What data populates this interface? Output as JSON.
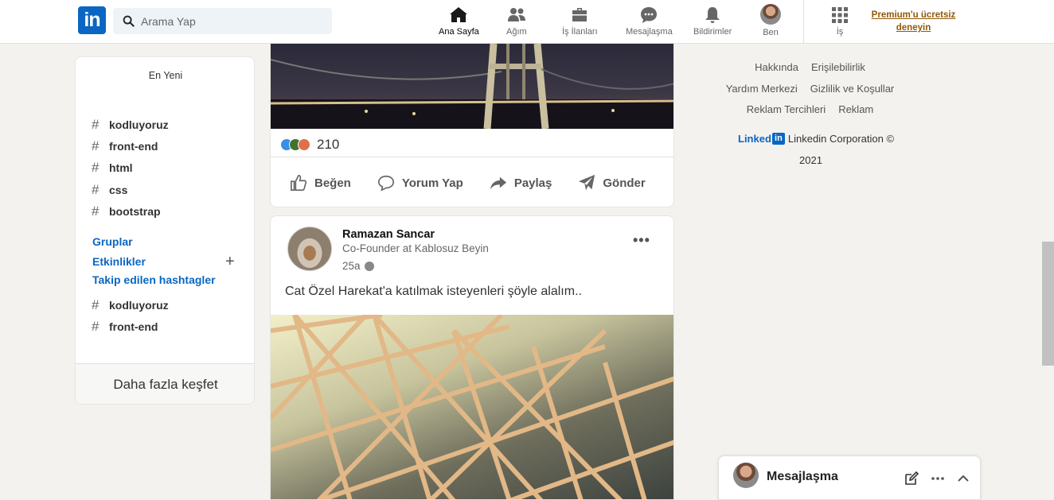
{
  "header": {
    "logo_text": "in",
    "search_placeholder": "Arama Yap",
    "nav": [
      {
        "label": "Ana Sayfa",
        "icon": "home-icon",
        "active": true
      },
      {
        "label": "Ağım",
        "icon": "network-icon"
      },
      {
        "label": "İş İlanları",
        "icon": "briefcase-icon"
      },
      {
        "label": "Mesajlaşma",
        "icon": "messaging-icon"
      },
      {
        "label": "Bildirimler",
        "icon": "bell-icon"
      },
      {
        "label": "Ben",
        "icon": "avatar"
      },
      {
        "label": "İş",
        "icon": "grid-icon"
      }
    ],
    "premium_text": "Premium'u ücretsiz deneyin"
  },
  "sidebar": {
    "recent_title": "En Yeni",
    "recent_tags": [
      "kodluyoruz",
      "front-end",
      "html",
      "css",
      "bootstrap"
    ],
    "groups_label": "Gruplar",
    "events_label": "Etkinlikler",
    "followed_label": "Takip edilen hashtagler",
    "followed_tags": [
      "kodluyoruz",
      "front-end"
    ],
    "discover_more": "Daha fazla keşfet"
  },
  "feed": {
    "post1": {
      "reaction_count": "210",
      "actions": [
        {
          "label": "Beğen",
          "icon": "like-icon"
        },
        {
          "label": "Yorum Yap",
          "icon": "comment-icon"
        },
        {
          "label": "Paylaş",
          "icon": "share-icon"
        },
        {
          "label": "Gönder",
          "icon": "send-icon"
        }
      ]
    },
    "post2": {
      "author_name": "Ramazan Sancar",
      "author_title": "Co-Founder at Kablosuz Beyin",
      "time": "25a",
      "text": "Cat Özel Harekat'a katılmak isteyenleri şöyle alalım.."
    }
  },
  "footer": {
    "row1": [
      "Hakkında",
      "Erişilebilirlik"
    ],
    "row2": [
      "Yardım Merkezi",
      "Gizlilik ve Koşullar"
    ],
    "row3": [
      "Reklam Tercihleri",
      "Reklam"
    ],
    "brand_word": "Linked",
    "brand_box": "in",
    "corporation": "Linkedin Corporation ©",
    "year": "2021"
  },
  "messaging": {
    "title": "Mesajlaşma"
  },
  "colors": {
    "brand_blue": "#0a66c2",
    "premium_gold": "#915907",
    "background": "#f3f2ef"
  }
}
